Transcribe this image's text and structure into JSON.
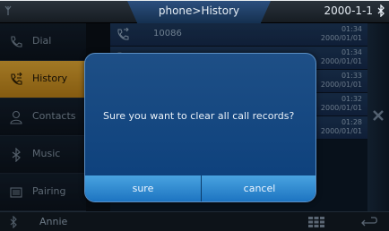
{
  "topbar": {
    "title": "phone>History",
    "date": "2000-1-1"
  },
  "sidebar": {
    "items": [
      {
        "label": "Dial",
        "icon": "phone-icon"
      },
      {
        "label": "History",
        "icon": "call-history-icon",
        "active": true
      },
      {
        "label": "Contacts",
        "icon": "person-icon"
      },
      {
        "label": "Music",
        "icon": "bluetooth-icon"
      },
      {
        "label": "Pairing",
        "icon": "pairing-icon"
      }
    ]
  },
  "call_list": [
    {
      "name": "10086",
      "time": "01:34",
      "date": "2000/01/01"
    },
    {
      "name": "",
      "time": "01:34",
      "date": "2000/01/01"
    },
    {
      "name": "",
      "time": "01:33",
      "date": "2000/01/01"
    },
    {
      "name": "",
      "time": "01:32",
      "date": "2000/01/01"
    },
    {
      "name": "",
      "time": "01:28",
      "date": "2000/01/01"
    }
  ],
  "bottombar": {
    "device_name": "Annie"
  },
  "dialog": {
    "message": "Sure you want to clear all call records?",
    "sure_label": "sure",
    "cancel_label": "cancel"
  },
  "colors": {
    "accent": "#c99028",
    "dialog": "#1a5da0",
    "button": "#3b95d8"
  }
}
